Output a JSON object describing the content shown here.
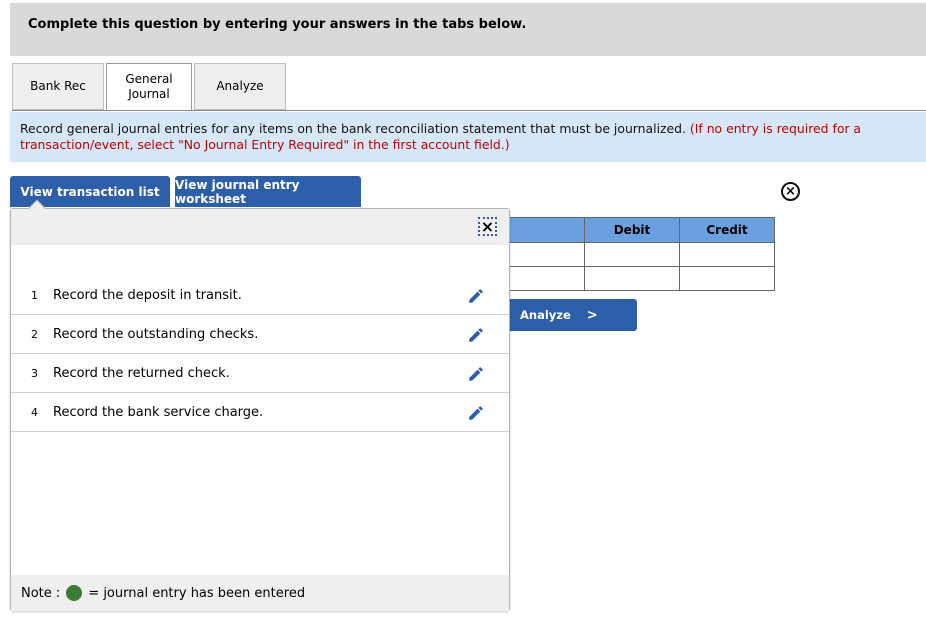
{
  "header": {
    "title": "Complete this question by entering your answers in the tabs below."
  },
  "tabs": [
    {
      "label": "Bank Rec",
      "active": false
    },
    {
      "label": "General\nJournal",
      "active": true
    },
    {
      "label": "Analyze",
      "active": false
    }
  ],
  "tab_labels": {
    "bank_rec": "Bank Rec",
    "general_line1": "General",
    "general_line2": "Journal",
    "analyze": "Analyze"
  },
  "instructions": {
    "main": "Record general journal entries for any items on the bank reconciliation statement that must be journalized.",
    "note": "(If no entry is required for a transaction/event, select \"No Journal Entry Required\" in the first account field.)"
  },
  "buttons": {
    "view_transaction_list": "View transaction list",
    "view_journal_entry_worksheet": "View journal entry worksheet",
    "analyze": "Analyze",
    "analyze_chevron": ">",
    "close_symbol": "×"
  },
  "worksheet": {
    "headers": [
      "",
      "Debit",
      "Credit"
    ],
    "rows": [
      [
        "",
        "",
        ""
      ],
      [
        "",
        "",
        ""
      ]
    ]
  },
  "transactions": [
    {
      "num": "1",
      "text": "Record the deposit in transit.",
      "icon": "pencil-icon"
    },
    {
      "num": "2",
      "text": "Record the outstanding checks.",
      "icon": "pencil-icon"
    },
    {
      "num": "3",
      "text": "Record the returned check.",
      "icon": "pencil-icon"
    },
    {
      "num": "4",
      "text": "Record the bank service charge.",
      "icon": "pencil-icon"
    }
  ],
  "footer_note": {
    "prefix": "Note :",
    "suffix": "= journal entry has been entered",
    "dot_color": "#3d7a35"
  },
  "colors": {
    "accent": "#2d5fa9",
    "table_header": "#6a9fe0",
    "instruction_bg": "#d6e8f7",
    "red_note": "#c00000"
  }
}
